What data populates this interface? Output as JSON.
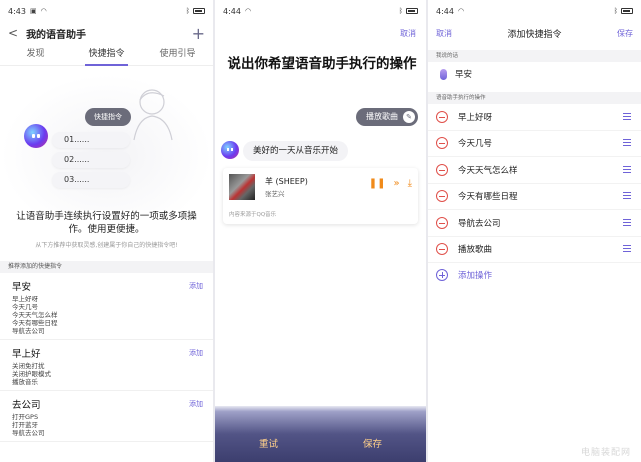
{
  "panel1": {
    "status": {
      "time": "4:43"
    },
    "header": {
      "back": "<",
      "title": "我的语音助手",
      "add": "+"
    },
    "tabs": [
      {
        "label": "发现"
      },
      {
        "label": "快捷指令"
      },
      {
        "label": "使用引导"
      }
    ],
    "illustration": {
      "tag": "快捷指令",
      "steps": [
        "01......",
        "02......",
        "03......"
      ]
    },
    "description": "让语音助手连续执行设置好的一项或多项操作。使用更便捷。",
    "hint": "从下方推荐中获取灵感,创建属于你自己的快捷指令吧!",
    "recommend_header": "推荐添加的快捷指令",
    "groups": [
      {
        "name": "早安",
        "add": "添加",
        "lines": [
          "早上好呀",
          "今天几号",
          "今天天气怎么样",
          "今天有哪些日程",
          "导航去公司"
        ]
      },
      {
        "name": "早上好",
        "add": "添加",
        "lines": [
          "关闭免打扰",
          "关闭护眼模式",
          "播放音乐"
        ]
      },
      {
        "name": "去公司",
        "add": "添加",
        "lines": [
          "打开GPS",
          "打开蓝牙",
          "导航去公司"
        ]
      }
    ]
  },
  "panel2": {
    "status": {
      "time": "4:44"
    },
    "cancel": "取消",
    "title": "说出你希望语音助手执行的操作",
    "chip": "播放歌曲",
    "reply": "美好的一天从音乐开始",
    "music": {
      "song": "羊 (SHEEP)",
      "artist": "张艺兴",
      "source": "内容来源于QQ音乐"
    },
    "retry": "重试",
    "save": "保存"
  },
  "panel3": {
    "status": {
      "time": "4:44"
    },
    "header": {
      "cancel": "取消",
      "title": "添加快捷指令",
      "save": "保存"
    },
    "say_label": "我说的话",
    "say_text": "早安",
    "actions_label": "语音助手执行的操作",
    "actions": [
      "早上好呀",
      "今天几号",
      "今天天气怎么样",
      "今天有哪些日程",
      "导航去公司",
      "播放歌曲"
    ],
    "add_action": "添加操作"
  },
  "watermark": "电脑装配网",
  "colors": {
    "accent": "#6f63d8",
    "danger": "#e0504a",
    "music_orange": "#f08a1a",
    "bottom_bar": "#3c3e6e"
  }
}
